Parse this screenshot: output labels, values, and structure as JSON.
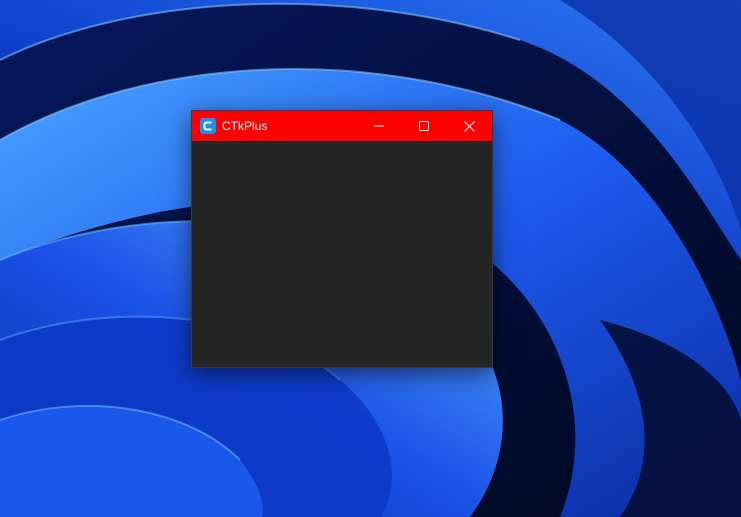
{
  "desktop": {
    "wallpaper": "windows-11-bloom-blue"
  },
  "window": {
    "title": "CTkPlus",
    "titlebar_color": "#ff0000",
    "client_color": "#242424",
    "title_color": "#ffffff",
    "icon": "ctkplus-app-icon",
    "icon_color": "#1f8ef1",
    "controls": {
      "minimize_icon": "minimize-icon",
      "maximize_icon": "maximize-icon",
      "close_icon": "close-icon"
    }
  }
}
